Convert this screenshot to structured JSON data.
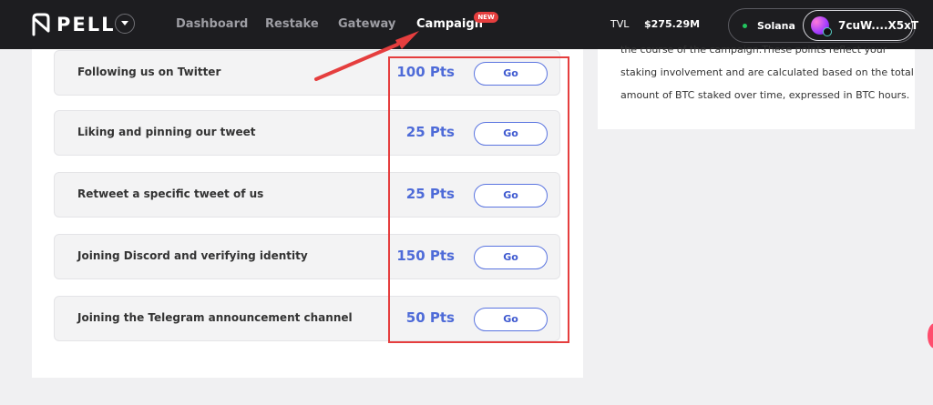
{
  "header": {
    "logo_text": "PELL",
    "nav": [
      "Dashboard",
      "Restake",
      "Gateway",
      "Campaign"
    ],
    "new_badge": "NEW",
    "tvl_label": "TVL",
    "tvl_value": "$275.29M",
    "chain": "Solana",
    "wallet_address": "7cuW....X5xT"
  },
  "tasks": [
    {
      "label": "Following us on Twitter",
      "points": "100 Pts",
      "button": "Go"
    },
    {
      "label": "Liking and pinning our tweet",
      "points": "25 Pts",
      "button": "Go"
    },
    {
      "label": "Retweet a specific tweet of us",
      "points": "25 Pts",
      "button": "Go"
    },
    {
      "label": "Joining Discord and verifying identity",
      "points": "150 Pts",
      "button": "Go"
    },
    {
      "label": "Joining the Telegram announcement channel",
      "points": "50 Pts",
      "button": "Go"
    }
  ],
  "info_panel": {
    "lines": [
      "the course of the campaign.These points reflect your",
      "staking involvement and are calculated based on the total",
      "amount of BTC staked over time, expressed in BTC hours."
    ]
  },
  "colors": {
    "header_bg": "#1d1d20",
    "accent_blue": "#4e6bd8",
    "annotation_red": "#e53e3e",
    "status_green": "#22c55e"
  }
}
